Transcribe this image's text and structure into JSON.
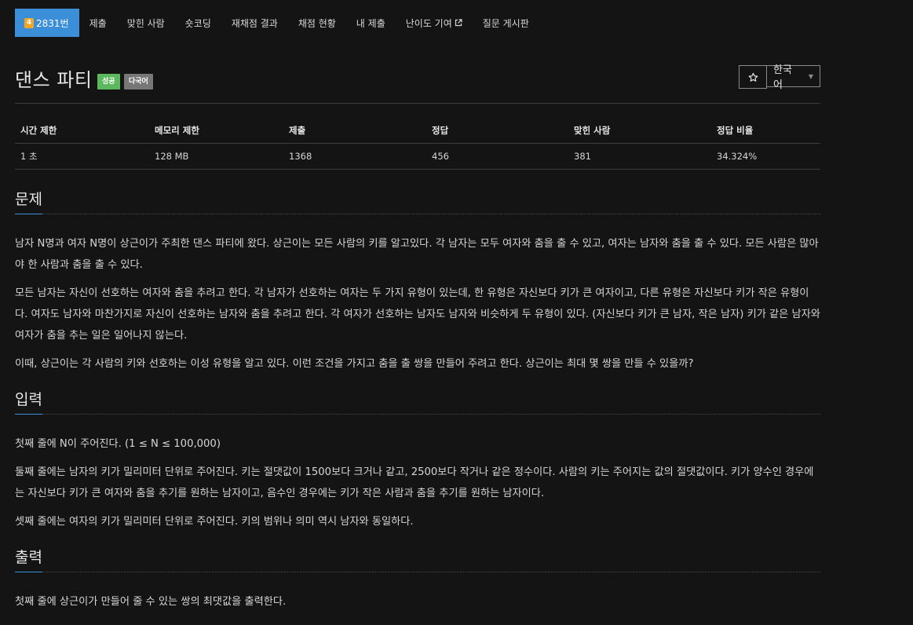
{
  "tabs": [
    {
      "label": "2831번",
      "tier": "4",
      "active": true
    },
    {
      "label": "제출"
    },
    {
      "label": "맞힌 사람"
    },
    {
      "label": "숏코딩"
    },
    {
      "label": "재채점 결과"
    },
    {
      "label": "채점 현황"
    },
    {
      "label": "내 제출"
    },
    {
      "label": "난이도 기여",
      "external": true
    },
    {
      "label": "질문 게시판"
    }
  ],
  "problem": {
    "title": "댄스 파티",
    "badge_success": "성공",
    "badge_multilang": "다국어",
    "star_icon": "star-icon",
    "language_selected": "한국어"
  },
  "info_table": {
    "headers": [
      "시간 제한",
      "메모리 제한",
      "제출",
      "정답",
      "맞힌 사람",
      "정답 비율"
    ],
    "values": [
      "1 초",
      "128 MB",
      "1368",
      "456",
      "381",
      "34.324%"
    ]
  },
  "sections": {
    "problem": {
      "heading": "문제",
      "paragraphs": [
        "남자 N명과 여자 N명이 상근이가 주최한 댄스 파티에 왔다. 상근이는 모든 사람의 키를 알고있다. 각 남자는 모두 여자와 춤을 출 수 있고, 여자는 남자와 춤을 출 수 있다. 모든 사람은 많아야 한 사람과 춤을 출 수 있다.",
        "모든 남자는 자신이 선호하는 여자와 춤을 추려고 한다. 각 남자가 선호하는 여자는 두 가지 유형이 있는데, 한 유형은 자신보다 키가 큰 여자이고, 다른 유형은 자신보다 키가 작은 유형이다. 여자도 남자와 마찬가지로 자신이 선호하는 남자와 춤을 추려고 한다. 각 여자가 선호하는 남자도 남자와 비슷하게 두 유형이 있다. (자신보다 키가 큰 남자, 작은 남자) 키가 같은 남자와 여자가 춤을 추는 일은 일어나지 않는다.",
        "이때, 상근이는 각 사람의 키와 선호하는 이성 유형을 알고 있다. 이런 조건을 가지고 춤을 출 쌍을 만들어 주려고 한다. 상근이는 최대 몇 쌍을 만들 수 있을까?"
      ]
    },
    "input": {
      "heading": "입력",
      "paragraphs": [
        "첫째 줄에 N이 주어진다. (1 ≤ N ≤ 100,000)",
        "둘째 줄에는 남자의 키가 밀리미터 단위로 주어진다. 키는 절댓값이 1500보다 크거나 같고, 2500보다 작거나 같은 정수이다. 사람의 키는 주어지는 값의 절댓값이다. 키가 양수인 경우에는 자신보다 키가 큰 여자와 춤을 추기를 원하는 남자이고, 음수인 경우에는 키가 작은 사람과 춤을 추기를 원하는 남자이다.",
        "셋째 줄에는 여자의 키가 밀리미터 단위로 주어진다. 키의 범위나 의미 역시 남자와 동일하다."
      ]
    },
    "output": {
      "heading": "출력",
      "paragraphs": [
        "첫째 줄에 상근이가 만들어 줄 수 있는 쌍의 최댓값을 출력한다."
      ]
    }
  },
  "colors": {
    "background": "#141414",
    "accent": "#3b8ed8",
    "success": "#5cb85c",
    "tier": "#f5a623"
  }
}
